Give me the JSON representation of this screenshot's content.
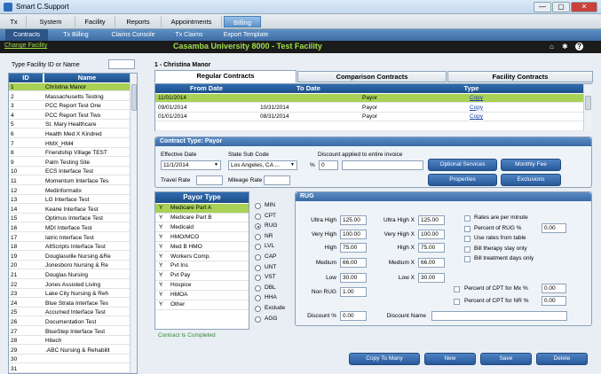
{
  "window": {
    "title": "Smart C.Support",
    "min": "—",
    "max": "▢",
    "close": "✕"
  },
  "menu": [
    "Tx",
    "System",
    "Facility",
    "Reports",
    "Appointments",
    "Billing"
  ],
  "submenu": [
    "Contracts",
    "Tx Billing",
    "Claims Console",
    "Tx Claims",
    "Export Template"
  ],
  "facility_bar": {
    "change_link": "Change Facility",
    "title": "Casamba University    8000 - Test Facility"
  },
  "search": {
    "label": "Type Facility ID or Name",
    "value": ""
  },
  "facility_list": {
    "headers": [
      "ID",
      "Name"
    ],
    "rows": [
      [
        "1",
        "Christina Manor"
      ],
      [
        "2",
        "Massachusetts Testing"
      ],
      [
        "3",
        "PCC Report Test One"
      ],
      [
        "4",
        "PCC Report Test Two"
      ],
      [
        "5",
        "St. Mary Healthcare"
      ],
      [
        "6",
        "Health Med X Kindred"
      ],
      [
        "7",
        "HMX_HM4"
      ],
      [
        "8",
        "Friendship Village TEST"
      ],
      [
        "9",
        "Palm Testing Site"
      ],
      [
        "10",
        "ECS Interface Test"
      ],
      [
        "11",
        "Momentum Interface Tes"
      ],
      [
        "12",
        "Medinformatix"
      ],
      [
        "13",
        "LG Interface Test"
      ],
      [
        "14",
        "Keane Interface Test"
      ],
      [
        "15",
        "Optimus Interface Test"
      ],
      [
        "16",
        "MDI Interface Test"
      ],
      [
        "17",
        "Iatric Interface Test"
      ],
      [
        "18",
        "AllScripts Interface Test"
      ],
      [
        "19",
        "Douglasville Nursing &Re"
      ],
      [
        "20",
        "Jonesboro Nursing & Re"
      ],
      [
        "21",
        "Douglas Nursing"
      ],
      [
        "22",
        "Jones Assisted Living"
      ],
      [
        "23",
        "Lake City Nursing & Reh"
      ],
      [
        "24",
        "Blue Strata Interface Tes"
      ],
      [
        "25",
        "Accumed Interface Test"
      ],
      [
        "26",
        "Documentation Test"
      ],
      [
        "27",
        "BlueStep Interface Test"
      ],
      [
        "28",
        "Hitech"
      ],
      [
        "29",
        ".ABC Nursing & Rehabilit"
      ],
      [
        "30",
        ""
      ],
      [
        "31",
        ""
      ]
    ]
  },
  "facility_heading": "1 - Christina Manor",
  "tabs": [
    "Regular Contracts",
    "Comparison Contracts",
    "Facility Contracts"
  ],
  "contracts_grid": {
    "headers": [
      "From Date",
      "To Date",
      "Type"
    ],
    "rows": [
      [
        "11/01/2014",
        "",
        "Payor",
        "Copy"
      ],
      [
        "09/01/2014",
        "10/31/2014",
        "Payor",
        "Copy"
      ],
      [
        "01/01/2014",
        "08/31/2014",
        "Payor",
        "Copy"
      ],
      [
        "",
        "",
        "",
        ""
      ]
    ]
  },
  "contract_type": {
    "header": "Contract Type: Payor",
    "eff_label": "Effective Date",
    "eff_value": "11/1/2014",
    "state_label": "State Sub Code",
    "state_value": "Los Angeles, CA ...",
    "discount_label": "Discount applied to entire invoice",
    "pct": "%",
    "discount_value": "0",
    "travel_label": "Travel Rate",
    "mileage_label": "Mileage Rate",
    "btn_optional": "Optional Services",
    "btn_monthly": "Monthly Fee",
    "btn_properties": "Properties",
    "btn_exclusions": "Exclusions"
  },
  "payor": {
    "header": "Payor Type",
    "rows": [
      [
        "Y",
        "Medicare Part A"
      ],
      [
        "Y",
        "Medicare Part B"
      ],
      [
        "Y",
        "Medicaid"
      ],
      [
        "Y",
        "HMO/MCO"
      ],
      [
        "Y",
        "Med B HMO"
      ],
      [
        "Y",
        "Workers Comp."
      ],
      [
        "Y",
        "Pvt Ins"
      ],
      [
        "Y",
        "Pvt Pay"
      ],
      [
        "Y",
        "Hospice"
      ],
      [
        "Y",
        "HMOA"
      ],
      [
        "Y",
        "Other"
      ]
    ]
  },
  "radios": [
    "MIN",
    "CPT",
    "RUG",
    "NR",
    "LVL",
    "CAP",
    "UNT",
    "VST",
    "DBL",
    "HHA",
    "Exclude",
    "AGG"
  ],
  "radio_selected": "RUG",
  "rug": {
    "header": "RUG",
    "left": [
      [
        "Ultra High",
        "125.00"
      ],
      [
        "Very High",
        "100.00"
      ],
      [
        "High",
        "75.00"
      ],
      [
        "Medium",
        "66.00"
      ],
      [
        "Low",
        "30.00"
      ],
      [
        "Non RUG",
        "1.00"
      ]
    ],
    "right": [
      [
        "Ultra High X",
        "125.00"
      ],
      [
        "Very High X",
        "100.00"
      ],
      [
        "High X",
        "75.00"
      ],
      [
        "Medium X",
        "66.00"
      ],
      [
        "Low X",
        "30.00"
      ]
    ],
    "opts": [
      "Rates are per minute",
      "Percent of RUG %",
      "Use rates from table",
      "Bill therapy stay only",
      "Bill treatment days only"
    ],
    "pct_rug": "0.00",
    "cpt_mx": "Percent of CPT for Mx %",
    "cpt_mx_val": "0.00",
    "cpt_nr": "Percent of CPT for NR %",
    "cpt_nr_val": "0.00",
    "discount_label": "Discount %",
    "discount_val": "0.00",
    "discount_name": "Discount Name"
  },
  "status": "Contract Is Completed",
  "buttons": {
    "copy": "Copy To Many",
    "new": "New",
    "save": "Save",
    "delete": "Delete"
  }
}
